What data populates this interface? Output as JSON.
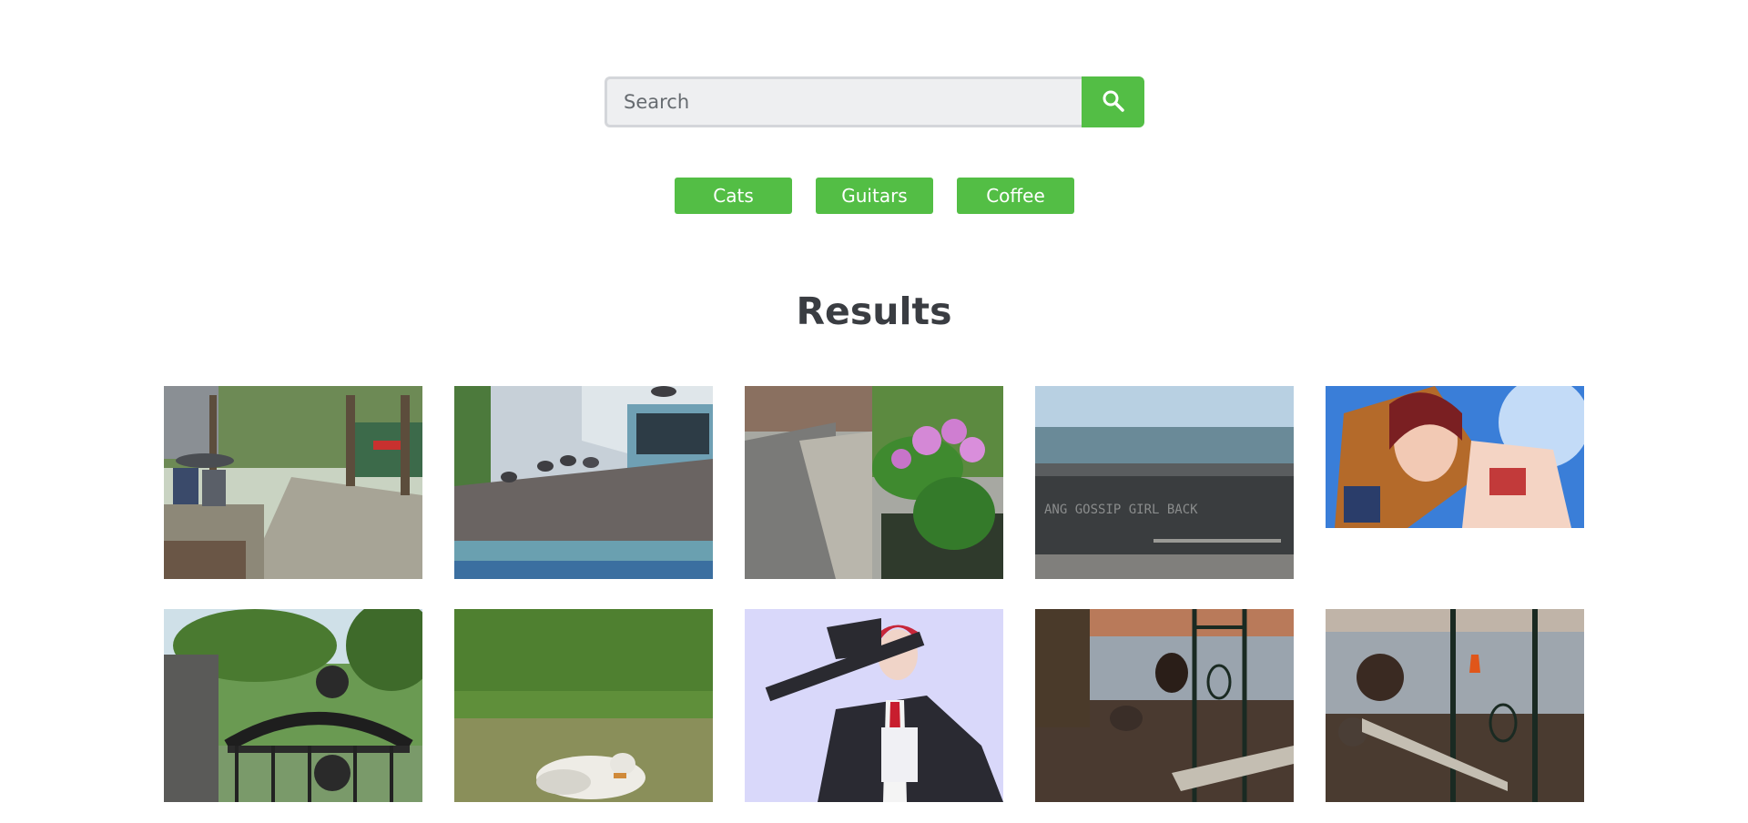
{
  "search": {
    "placeholder": "Search",
    "value": "",
    "button_icon": "search-icon"
  },
  "tags": [
    {
      "label": "Cats"
    },
    {
      "label": "Guitars"
    },
    {
      "label": "Coffee"
    }
  ],
  "results_heading": "Results",
  "colors": {
    "accent": "#53be45",
    "heading": "#3a3d42",
    "input_bg": "#eeeff1"
  },
  "results": [
    {
      "subject": "park-walkway-with-couple-under-umbrella"
    },
    {
      "subject": "pigeons-on-gazebo-roof"
    },
    {
      "subject": "pink-flowers-by-sidewalk"
    },
    {
      "subject": "seawall-with-chalk-writing"
    },
    {
      "subject": "rendered-character-in-leopard-jacket"
    },
    {
      "subject": "cemetery-iron-gate"
    },
    {
      "subject": "white-goose-in-grass"
    },
    {
      "subject": "rendered-character-in-suit-with-axe"
    },
    {
      "subject": "turkeys-near-metal-gate"
    },
    {
      "subject": "turkeys-on-street-corner"
    }
  ]
}
